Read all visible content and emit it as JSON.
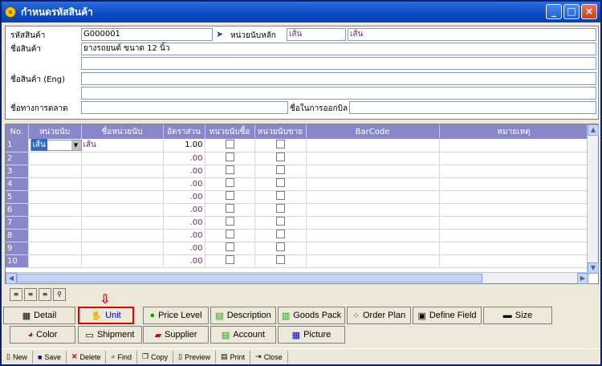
{
  "window": {
    "title": "กำหนดรหัสสินค้า",
    "buttons": [
      "_",
      "□",
      "×"
    ]
  },
  "form": {
    "product_code_label": "รหัสสินค้า",
    "product_code": "G000001",
    "main_unit_label": "หน่วยนับหลัก",
    "main_unit_code": "เส้น",
    "main_unit_name": "เส้น",
    "product_name_label": "ชื่อสินค้า",
    "product_name": "ยางรถยนต์ ขนาด 12 นิ้ว",
    "product_name_eng_label": "ชื่อสินค้า (Eng)",
    "market_name_label": "ชื่อทางการตลาด",
    "invoice_name_label": "ชื่อในการออกบิล"
  },
  "grid": {
    "headers": [
      "No.",
      "หน่วยนับ",
      "ชื่อหน่วยนับ",
      "อัตราส่วน",
      "หน่วยนับซื้อ",
      "หน่วยนับขาย",
      "BarCode",
      "หมายเหตุ"
    ],
    "rows": [
      {
        "no": "1",
        "unit": "เส้น",
        "unit_name": "เส้น",
        "rate": "1.00"
      },
      {
        "no": "2",
        "unit": "",
        "unit_name": "",
        "rate": ".00"
      },
      {
        "no": "3",
        "unit": "",
        "unit_name": "",
        "rate": ".00"
      },
      {
        "no": "4",
        "unit": "",
        "unit_name": "",
        "rate": ".00"
      },
      {
        "no": "5",
        "unit": "",
        "unit_name": "",
        "rate": ".00"
      },
      {
        "no": "6",
        "unit": "",
        "unit_name": "",
        "rate": ".00"
      },
      {
        "no": "7",
        "unit": "",
        "unit_name": "",
        "rate": ".00"
      },
      {
        "no": "8",
        "unit": "",
        "unit_name": "",
        "rate": ".00"
      },
      {
        "no": "9",
        "unit": "",
        "unit_name": "",
        "rate": ".00"
      },
      {
        "no": "10",
        "unit": "",
        "unit_name": "",
        "rate": ".00"
      }
    ]
  },
  "tabs": {
    "detail": "Detail",
    "unit": "Unit",
    "price_level": "Price Level",
    "description": "Description",
    "goods_pack": "Goods Pack",
    "order_plan": "Order Plan",
    "define_field": "Define Field",
    "size": "Size",
    "color": "Color",
    "shipment": "Shipment",
    "supplier": "Supplier",
    "account": "Account",
    "picture": "Picture"
  },
  "toolbar": {
    "new": "New",
    "save": "Save",
    "delete": "Delete",
    "find": "Find",
    "copy": "Copy",
    "preview": "Preview",
    "print": "Print",
    "close": "Close"
  }
}
